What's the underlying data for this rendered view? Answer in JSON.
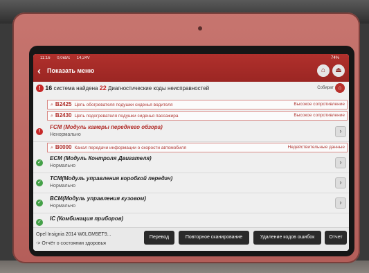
{
  "statusbar": {
    "time": "11:16",
    "speed": "0,0кв/с",
    "voltage": "14,24V",
    "battery": "74%"
  },
  "header": {
    "back_icon": "‹",
    "title": "Показать меню",
    "home_icon": "⌂",
    "exit_icon": "⏏"
  },
  "summary": {
    "system_count": "16",
    "text1": " система найдена ",
    "code_count": "22",
    "text2": " Диагностические коды неисправностей",
    "collect_label": "Собират"
  },
  "fault_codes_1": [
    {
      "code": "B2425",
      "desc": "Цепь обогревателя подушки сиденья водителя",
      "state": "Высокое сопротивление"
    },
    {
      "code": "B2430",
      "desc": "Цепь подогревателя подушки сиденья пассажира",
      "state": "Высокое сопротивление"
    }
  ],
  "modules": [
    {
      "name": "FCM (Модуль камеры переднего обзора)",
      "state": "Ненормально",
      "status": "err"
    },
    {
      "name": "ECM (Модуль Контроля Двигателя)",
      "state": "Нормально",
      "status": "ok"
    },
    {
      "name": "TCM(Модуль управления коробкой передач)",
      "state": "Нормально",
      "status": "ok"
    },
    {
      "name": "BCM(Модуль управления кузовом)",
      "state": "Нормально",
      "status": "ok"
    },
    {
      "name": "IC (Комбинация приборов)",
      "state": "",
      "status": "ok"
    }
  ],
  "fault_codes_2": [
    {
      "code": "B0000",
      "desc": "Канал передачи информации о скорости автомобиля",
      "state": "Недействительные данные"
    }
  ],
  "footer": {
    "vehicle": "Opel Insignia 2014  W0LGM5ET9...",
    "health": "-> Отчёт о состоянии здоровья",
    "translate": "Перевод",
    "rescan": "Повторное сканирование",
    "clear": "Удаление кодов ошибок",
    "report": "Отчет"
  },
  "colors": {
    "header": "#a82b27",
    "accent": "#c62828",
    "ok": "#43a047"
  }
}
